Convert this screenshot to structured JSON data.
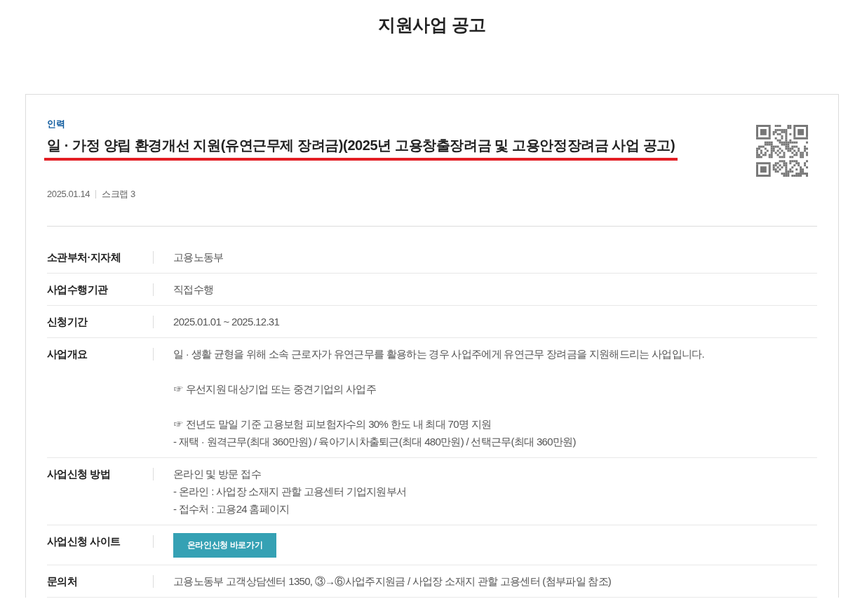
{
  "page_title": "지원사업 공고",
  "notice": {
    "category": "인력",
    "title": "일 · 가정 양립 환경개선 지원(유연근무제 장려금)(2025년 고용창출장려금 및 고용안정장려금 사업 공고)",
    "date": "2025.01.14",
    "scrap": "스크랩 3"
  },
  "details": [
    {
      "kind": "text",
      "label": "소관부처·지자체",
      "paragraphs": [
        [
          "고용노동부"
        ]
      ]
    },
    {
      "kind": "text",
      "label": "사업수행기관",
      "paragraphs": [
        [
          "직접수행"
        ]
      ]
    },
    {
      "kind": "text",
      "label": "신청기간",
      "paragraphs": [
        [
          "2025.01.01 ~ 2025.12.31"
        ]
      ]
    },
    {
      "kind": "text",
      "label": "사업개요",
      "paragraphs": [
        [
          "일 · 생활 균형을 위해 소속 근로자가 유연근무를 활용하는 경우 사업주에게 유연근무 장려금을 지원해드리는 사업입니다."
        ],
        [
          "☞ 우선지원 대상기업 또는 중견기업의 사업주"
        ],
        [
          "☞ 전년도 말일 기준 고용보험 피보험자수의 30% 한도 내 최대 70명 지원",
          "- 재택 · 원격근무(최대 360만원) / 육아기시차출퇴근(최대 480만원) / 선택근무(최대 360만원)"
        ]
      ]
    },
    {
      "kind": "text",
      "label": "사업신청 방법",
      "paragraphs": [
        [
          "온라인 및 방문 접수",
          "- 온라인 : 사업장 소재지 관할 고용센터 기업지원부서",
          "- 접수처 : 고용24 홈페이지"
        ]
      ]
    },
    {
      "kind": "button",
      "label": "사업신청 사이트",
      "button": "온라인신청 바로가기"
    },
    {
      "kind": "text",
      "label": "문의처",
      "paragraphs": [
        [
          "고용노동부 고객상담센터 1350, ③→⑥사업주지원금 / 사업장 소재지 관할 고용센터 (첨부파일 참조)"
        ]
      ]
    }
  ]
}
